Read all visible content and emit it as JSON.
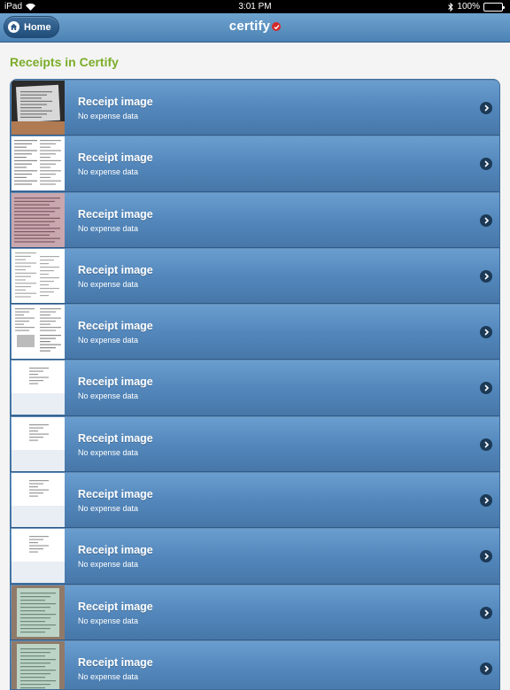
{
  "status_bar": {
    "carrier": "iPad",
    "time": "3:01 PM",
    "battery": "100%"
  },
  "nav": {
    "home_label": "Home",
    "brand": "certify"
  },
  "section_title": "Receipts in Certify",
  "receipts": [
    {
      "title": "Receipt image",
      "subtitle": "No expense data",
      "thumb": "photo-dark"
    },
    {
      "title": "Receipt image",
      "subtitle": "No expense data",
      "thumb": "doc-dense"
    },
    {
      "title": "Receipt image",
      "subtitle": "No expense data",
      "thumb": "doc-pink"
    },
    {
      "title": "Receipt image",
      "subtitle": "No expense data",
      "thumb": "doc-light"
    },
    {
      "title": "Receipt image",
      "subtitle": "No expense data",
      "thumb": "doc-mixed"
    },
    {
      "title": "Receipt image",
      "subtitle": "No expense data",
      "thumb": "doc-small"
    },
    {
      "title": "Receipt image",
      "subtitle": "No expense data",
      "thumb": "doc-small"
    },
    {
      "title": "Receipt image",
      "subtitle": "No expense data",
      "thumb": "doc-small"
    },
    {
      "title": "Receipt image",
      "subtitle": "No expense data",
      "thumb": "doc-small"
    },
    {
      "title": "Receipt image",
      "subtitle": "No expense data",
      "thumb": "photo-green"
    },
    {
      "title": "Receipt image",
      "subtitle": "No expense data",
      "thumb": "photo-green"
    }
  ]
}
